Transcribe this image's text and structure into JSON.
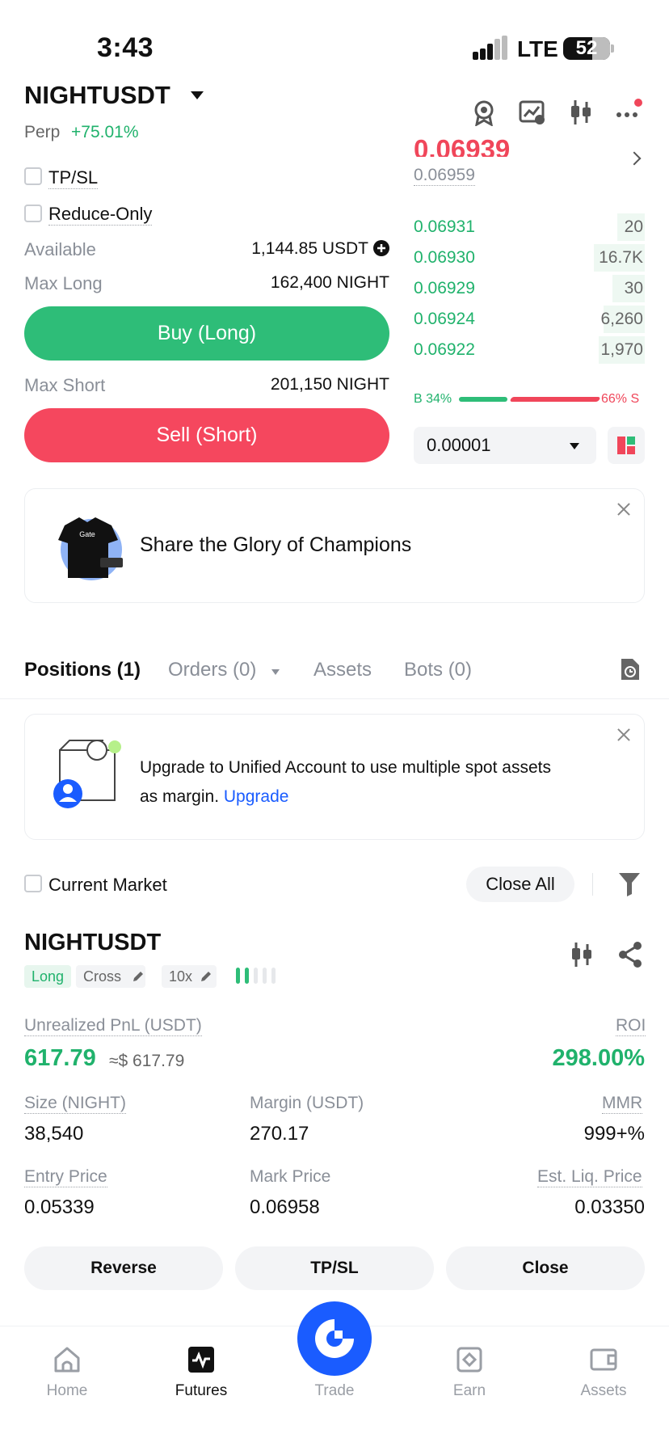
{
  "status_bar": {
    "time": "3:43",
    "network": "LTE",
    "battery": "52"
  },
  "header": {
    "pair": "NIGHTUSDT",
    "type": "Perp",
    "change": "+75.01%"
  },
  "order_form": {
    "tpsl_label": "TP/SL",
    "reduce_only_label": "Reduce-Only",
    "available_label": "Available",
    "available_value": "1,144.85 USDT",
    "max_long_label": "Max Long",
    "max_long_value": "162,400 NIGHT",
    "buy_label": "Buy (Long)",
    "max_short_label": "Max Short",
    "max_short_value": "201,150 NIGHT",
    "sell_label": "Sell (Short)"
  },
  "order_book": {
    "last_price": "0.06939",
    "mark_price": "0.06959",
    "bids": [
      {
        "price": "0.06931",
        "qty": "20",
        "depth": 0.12
      },
      {
        "price": "0.06930",
        "qty": "16.7K",
        "depth": 0.22
      },
      {
        "price": "0.06929",
        "qty": "30",
        "depth": 0.14
      },
      {
        "price": "0.06924",
        "qty": "6,260",
        "depth": 0.18
      },
      {
        "price": "0.06922",
        "qty": "1,970",
        "depth": 0.2
      }
    ],
    "buy_ratio": "B 34%",
    "sell_ratio": "66% S",
    "tick_size": "0.00001"
  },
  "promo": {
    "text": "Share the Glory of Champions",
    "shirt_brand": "Gate"
  },
  "tabs": [
    {
      "label": "Positions (1)"
    },
    {
      "label": "Orders (0)"
    },
    {
      "label": "Assets"
    },
    {
      "label": "Bots (0)"
    }
  ],
  "upgrade_banner": {
    "text": "Upgrade to Unified Account to use multiple spot assets as margin.",
    "line1": "Upgrade to Unified Account to use multiple spot assets",
    "line2": "as margin.",
    "link": "Upgrade"
  },
  "filters": {
    "current_market_label": "Current Market",
    "close_all_label": "Close All"
  },
  "position": {
    "symbol": "NIGHTUSDT",
    "side": "Long",
    "margin_mode": "Cross",
    "leverage": "10x",
    "pnl_label": "Unrealized PnL (USDT)",
    "pnl_value": "617.79",
    "pnl_usd": "≈$ 617.79",
    "roi_label": "ROI",
    "roi_value": "298.00%",
    "size_label": "Size (NIGHT)",
    "size_value": "38,540",
    "margin_label": "Margin (USDT)",
    "margin_value": "270.17",
    "mmr_label": "MMR",
    "mmr_value": "999+%",
    "entry_label": "Entry Price",
    "entry_value": "0.05339",
    "mark_label": "Mark Price",
    "mark_value": "0.06958",
    "liq_label": "Est. Liq. Price",
    "liq_value": "0.03350",
    "reverse_label": "Reverse",
    "tpsl_label": "TP/SL",
    "close_label": "Close"
  },
  "nav": {
    "home": "Home",
    "futures": "Futures",
    "trade": "Trade",
    "earn": "Earn",
    "assets": "Assets"
  },
  "colors": {
    "green": "#20b26c",
    "red": "#f0465a",
    "orange": "#f5922f",
    "blue": "#1a5cff"
  }
}
